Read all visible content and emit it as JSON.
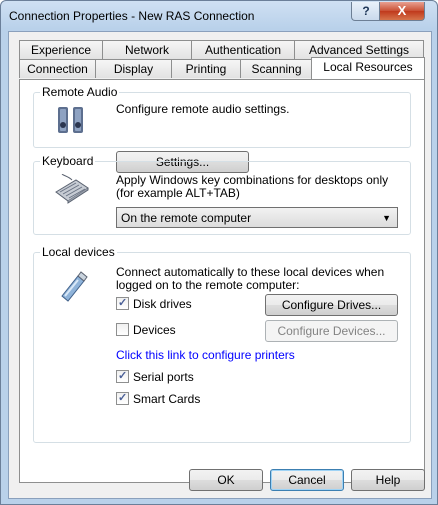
{
  "window": {
    "title": "Connection Properties - New RAS Connection",
    "help_glyph": "?",
    "close_glyph": "X"
  },
  "tabs": {
    "row1": [
      "Experience",
      "Network",
      "Authentication",
      "Advanced Settings"
    ],
    "row2": [
      "Connection",
      "Display",
      "Printing",
      "Scanning",
      "Local Resources"
    ],
    "active": "Local Resources"
  },
  "remote_audio": {
    "label": "Remote Audio",
    "description": "Configure remote audio settings.",
    "settings_button": "Settings..."
  },
  "keyboard": {
    "label": "Keyboard",
    "description_line1": "Apply Windows key combinations for desktops only",
    "description_line2": "(for example ALT+TAB)",
    "combo_value": "On the remote computer"
  },
  "local_devices": {
    "label": "Local devices",
    "description_line1": "Connect automatically to these local devices when",
    "description_line2": "logged on to the remote computer:",
    "disk_drives": {
      "label": "Disk drives",
      "checked": true
    },
    "configure_drives_button": "Configure Drives...",
    "devices": {
      "label": "Devices",
      "checked": false
    },
    "configure_devices_button": "Configure Devices...",
    "printers_link": "Click this link to configure printers",
    "serial_ports": {
      "label": "Serial ports",
      "checked": true
    },
    "smart_cards": {
      "label": "Smart Cards",
      "checked": true
    }
  },
  "footer": {
    "ok": "OK",
    "cancel": "Cancel",
    "help": "Help"
  }
}
